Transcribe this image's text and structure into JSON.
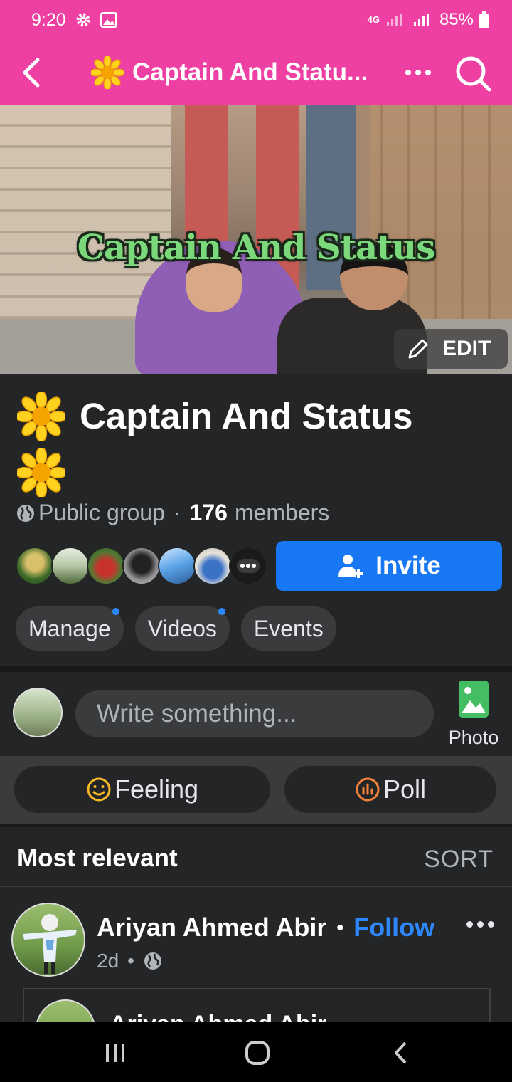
{
  "status_bar": {
    "time": "9:20",
    "network": "4G",
    "battery": "85%"
  },
  "topbar": {
    "title": "Captain And Statu...",
    "title_icon": "sunflower-icon",
    "accent_color": "#ee3fa3"
  },
  "cover": {
    "overlay_text": "Captain And Status",
    "edit_label": "EDIT"
  },
  "group": {
    "name": "Captain And Status",
    "privacy": "Public group",
    "separator": "·",
    "member_count": "176",
    "members_label": "members",
    "invite_label": "Invite",
    "more_members_icon": "more-dots-icon"
  },
  "tabs": [
    {
      "label": "Manage",
      "has_dot": true
    },
    {
      "label": "Videos",
      "has_dot": true
    },
    {
      "label": "Events",
      "has_dot": false
    }
  ],
  "composer": {
    "placeholder": "Write something...",
    "photo_label": "Photo"
  },
  "actions": {
    "feeling_label": "Feeling",
    "poll_label": "Poll"
  },
  "sortbar": {
    "label": "Most relevant",
    "sort_label": "SORT"
  },
  "post": {
    "author": "Ariyan Ahmed Abir",
    "bullet": "•",
    "follow_label": "Follow",
    "time": "2d",
    "meta_bullet": "•",
    "shared_author": "Ariyan Ahmed Abir"
  },
  "colors": {
    "brand_pink": "#ee3fa3",
    "primary_blue": "#1877f2",
    "link_blue": "#2d88ff",
    "background": "#242526"
  }
}
